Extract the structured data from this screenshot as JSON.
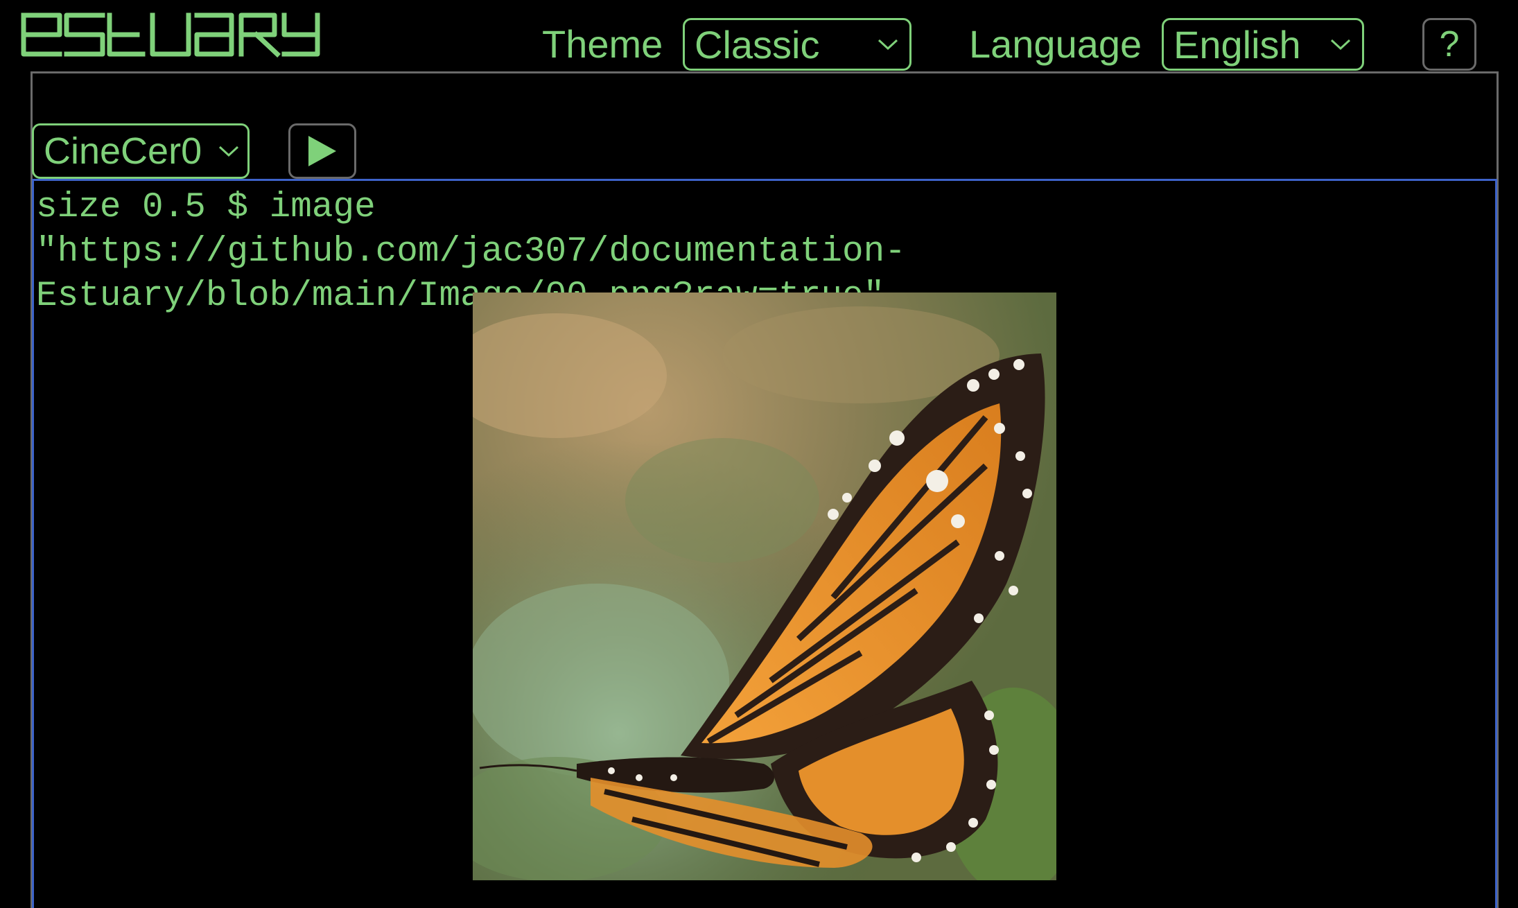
{
  "app": {
    "logo_text": "estuary"
  },
  "header": {
    "theme_label": "Theme",
    "theme_value": "Classic",
    "language_label": "Language",
    "language_value": "English",
    "help_label": "?"
  },
  "toolbar": {
    "language_select_value": "CineCer0",
    "play_icon": "play-icon"
  },
  "editor": {
    "code": "size 0.5 $ image \"https://github.com/jac307/documentation-\nEstuary/blob/main/Image/00.png?raw=true\""
  },
  "output": {
    "image_subject": "monarch butterfly"
  },
  "colors": {
    "accent": "#7fd17a",
    "background": "#000000",
    "frame_border": "#6a6a6a",
    "editor_border": "#3d63c9"
  }
}
